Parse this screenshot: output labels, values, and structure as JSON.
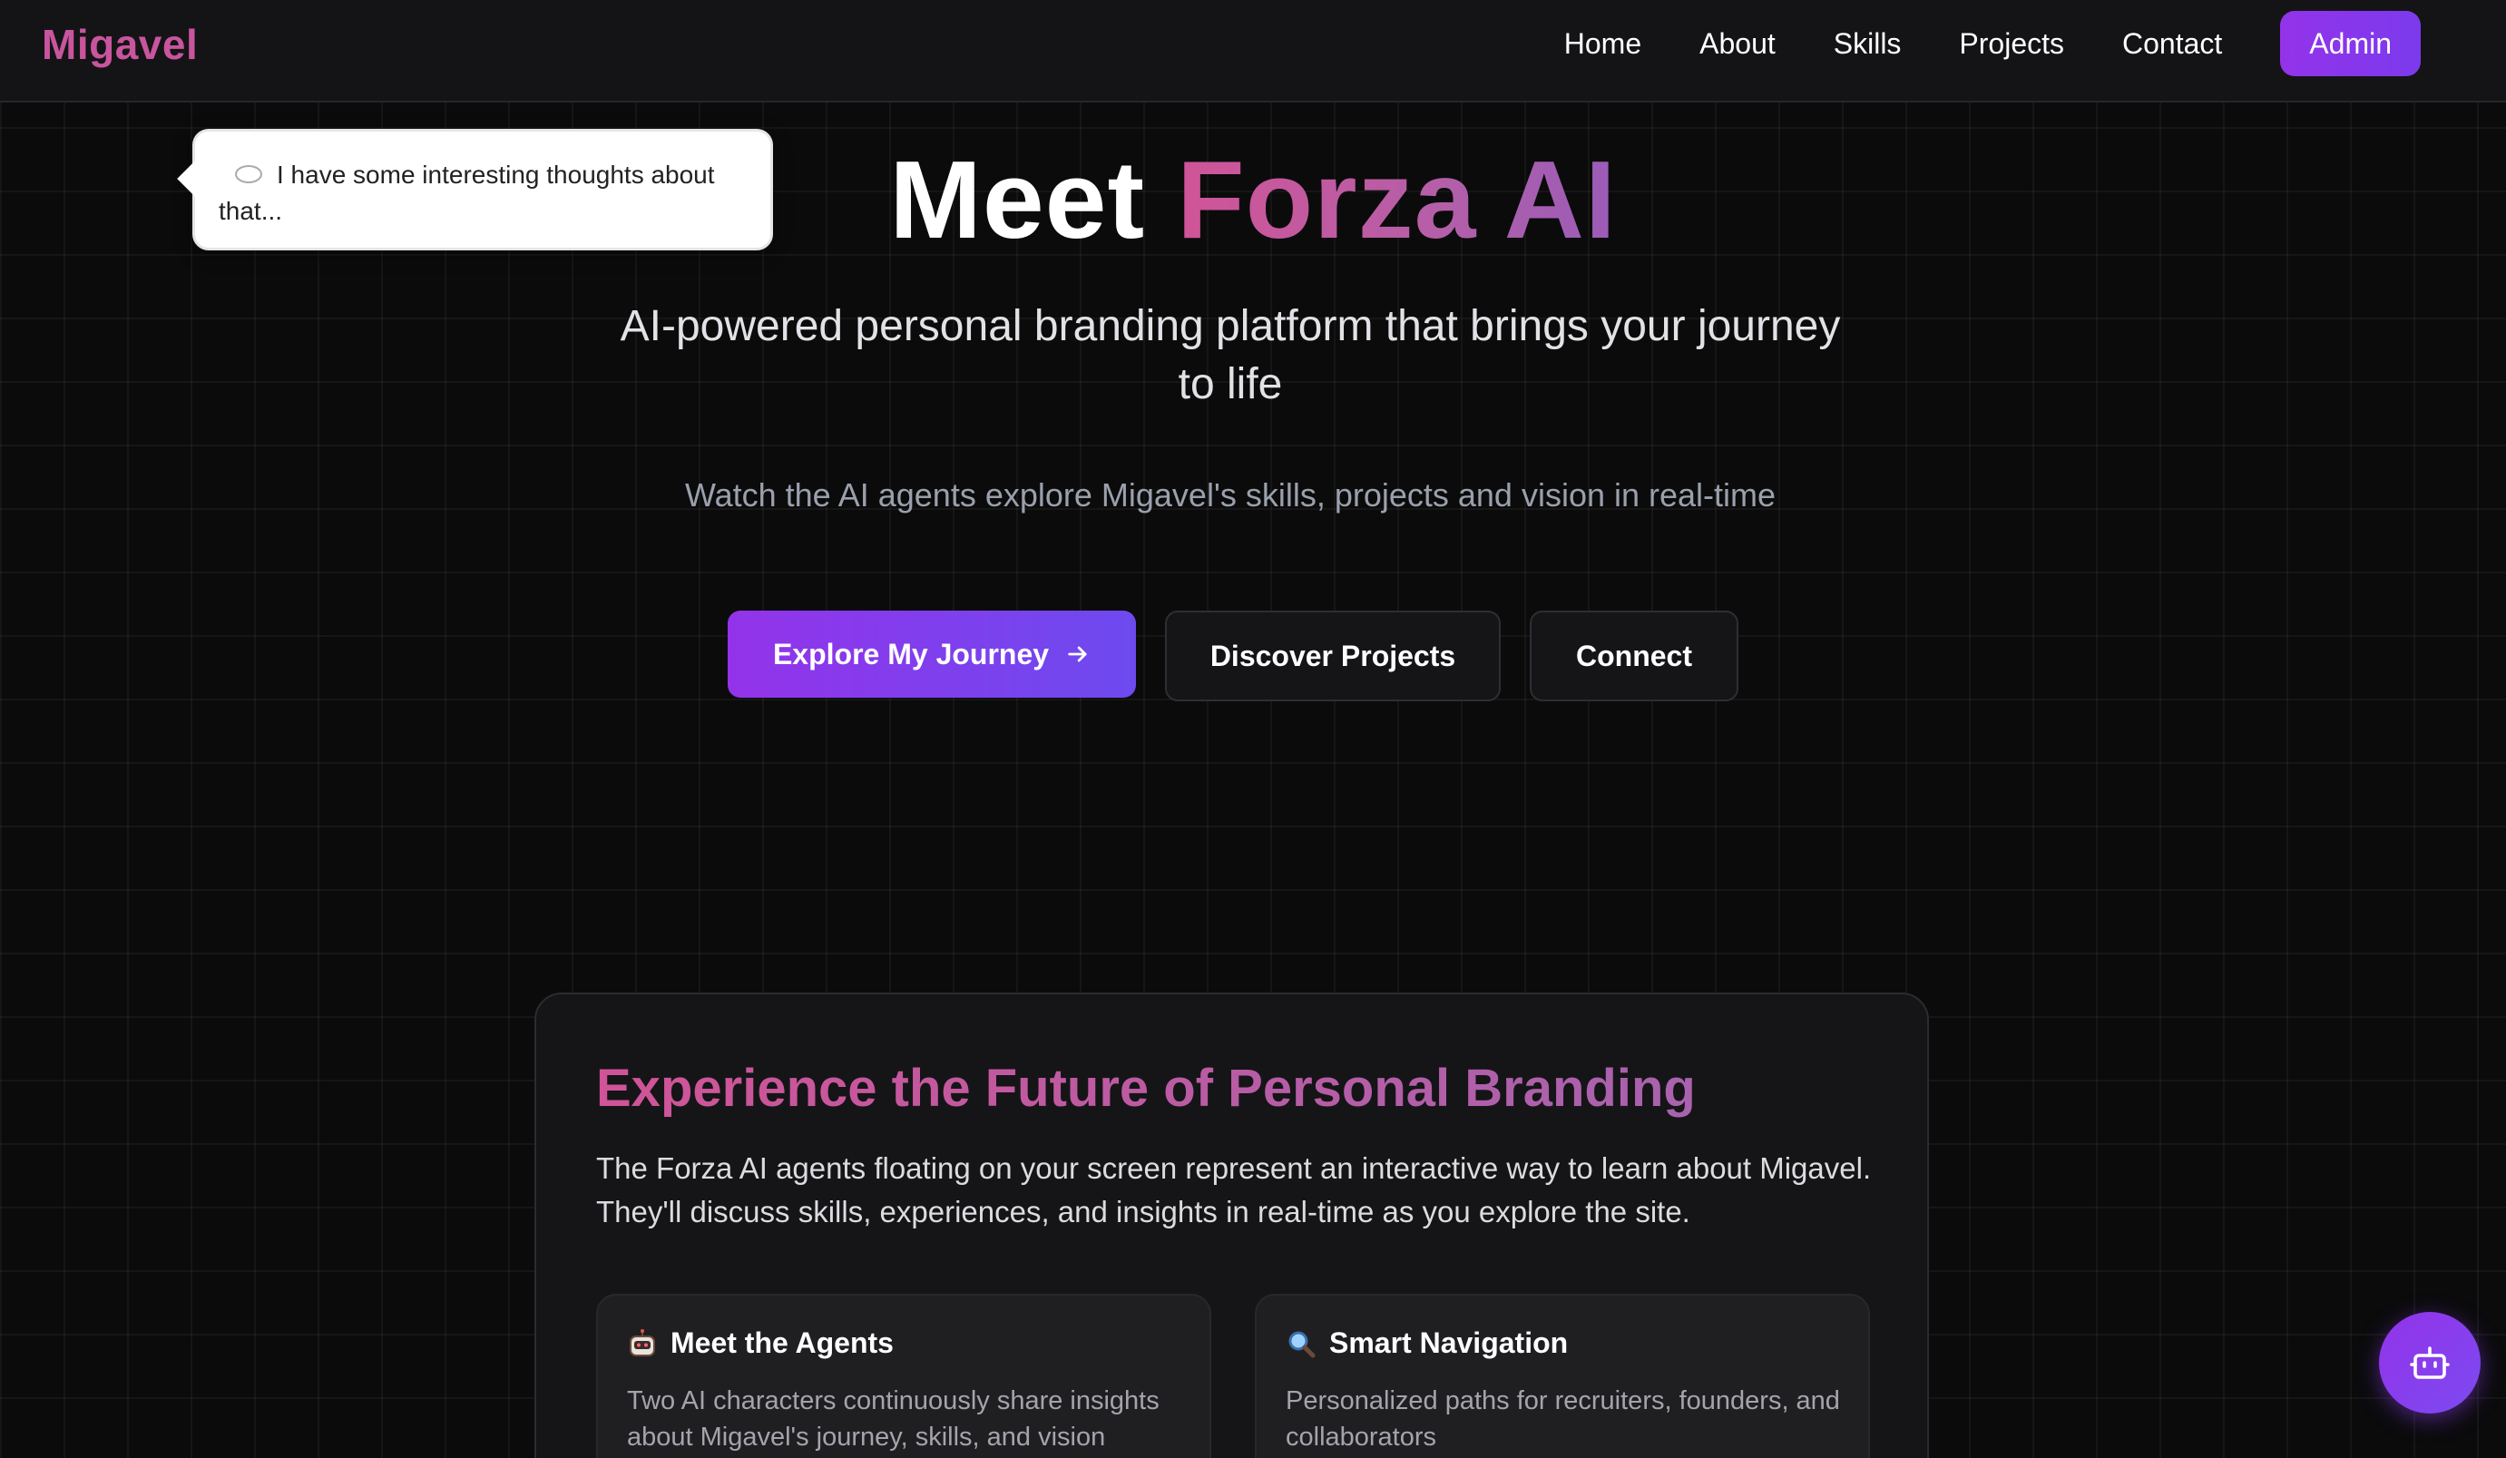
{
  "nav": {
    "brand": "Migavel",
    "links": [
      "Home",
      "About",
      "Skills",
      "Projects",
      "Contact"
    ],
    "admin_label": "Admin"
  },
  "bubble": {
    "text": "I have some interesting thoughts about that..."
  },
  "hero": {
    "title_plain": "Meet",
    "title_accent": "Forza AI",
    "subtitle": "AI-powered personal branding platform that brings your journey to life",
    "note": "Watch the AI agents explore Migavel's skills, projects and vision in real-time",
    "cta_primary": "Explore My Journey",
    "cta_discover": "Discover Projects",
    "cta_connect": "Connect"
  },
  "feature": {
    "title": "Experience the Future of Personal Branding",
    "description": "The Forza AI agents floating on your screen represent an interactive way to learn about Migavel. They'll discuss skills, experiences, and insights in real-time as you explore the site.",
    "cards": [
      {
        "icon": "robot-icon",
        "title": "Meet the Agents",
        "description": "Two AI characters continuously share insights about Migavel's journey, skills, and vision"
      },
      {
        "icon": "magnifier-icon",
        "title": "Smart Navigation",
        "description": "Personalized paths for recruiters, founders, and collaborators"
      }
    ]
  },
  "colors": {
    "accent_pink": "#d05497",
    "accent_purple": "#9333ea",
    "background": "#0b0b0c"
  }
}
